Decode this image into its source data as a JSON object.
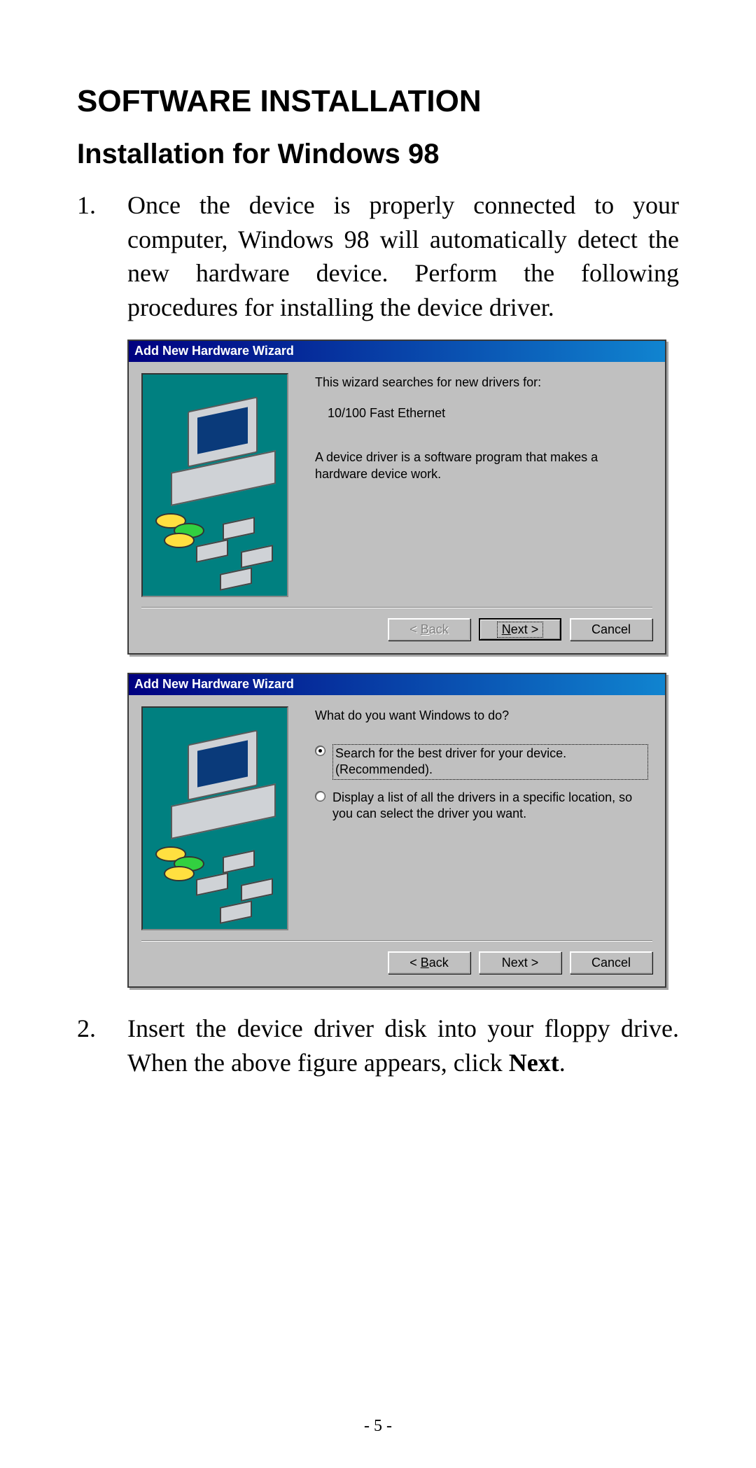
{
  "heading1": "SOFTWARE INSTALLATION",
  "heading2": "Installation for Windows 98",
  "step1": {
    "num": "1.",
    "text": "Once the device is properly connected to your computer, Windows 98 will automatically detect the new hardware device. Perform the following procedures for installing the device driver."
  },
  "step2": {
    "num": "2.",
    "prefix": "Insert the device driver disk into your floppy drive. When the above figure appears, click ",
    "bold": "Next",
    "suffix": "."
  },
  "dlg1": {
    "title": "Add New Hardware Wizard",
    "line1": "This wizard searches for new drivers for:",
    "device": "10/100 Fast Ethernet",
    "line2": "A device driver is a software program that makes a hardware device work.",
    "back_u": "B",
    "back_rest": "ack",
    "next_u": "N",
    "next_rest": "ext >",
    "cancel": "Cancel"
  },
  "dlg2": {
    "title": "Add New Hardware Wizard",
    "prompt": "What do you want Windows to do?",
    "opt1": "Search for the best driver for your device. (Recommended).",
    "opt2": "Display a list of all the drivers in a specific location, so you can select the driver you want.",
    "back_u": "B",
    "back_rest": "ack",
    "next_label": "Next >",
    "cancel": "Cancel"
  },
  "page_number": "- 5 -"
}
